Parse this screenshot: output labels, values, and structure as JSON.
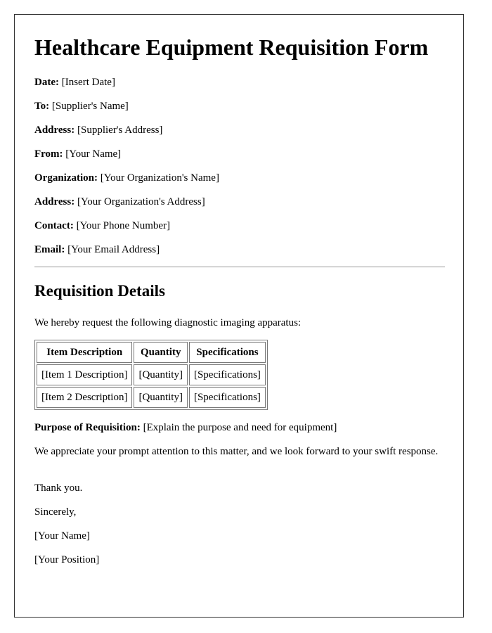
{
  "title": "Healthcare Equipment Requisition Form",
  "header_fields": [
    {
      "label": "Date:",
      "value": "[Insert Date]"
    },
    {
      "label": "To:",
      "value": "[Supplier's Name]"
    },
    {
      "label": "Address:",
      "value": "[Supplier's Address]"
    },
    {
      "label": "From:",
      "value": "[Your Name]"
    },
    {
      "label": "Organization:",
      "value": "[Your Organization's Name]"
    },
    {
      "label": "Address:",
      "value": "[Your Organization's Address]"
    },
    {
      "label": "Contact:",
      "value": "[Your Phone Number]"
    },
    {
      "label": "Email:",
      "value": "[Your Email Address]"
    }
  ],
  "details": {
    "heading": "Requisition Details",
    "intro": "We hereby request the following diagnostic imaging apparatus:",
    "table": {
      "headers": [
        "Item Description",
        "Quantity",
        "Specifications"
      ],
      "rows": [
        [
          "[Item 1 Description]",
          "[Quantity]",
          "[Specifications]"
        ],
        [
          "[Item 2 Description]",
          "[Quantity]",
          "[Specifications]"
        ]
      ]
    },
    "purpose_label": "Purpose of Requisition:",
    "purpose_value": "[Explain the purpose and need for equipment]"
  },
  "closing": {
    "appreciation": "We appreciate your prompt attention to this matter, and we look forward to your swift response.",
    "thanks": "Thank you.",
    "signoff": "Sincerely,",
    "name": "[Your Name]",
    "position": "[Your Position]"
  }
}
